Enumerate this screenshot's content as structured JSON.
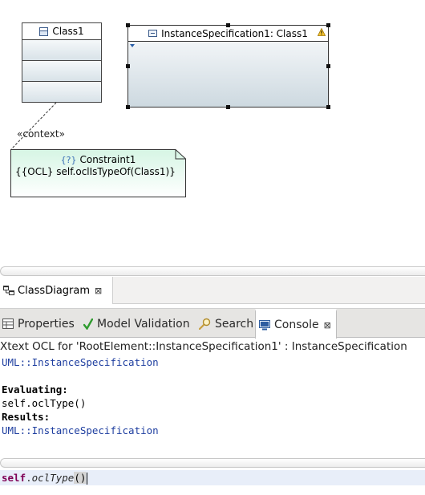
{
  "diagram": {
    "class_name": "Class1",
    "instance_label": "InstanceSpecification1: Class1",
    "context_label": "«context»",
    "constraint_name": "Constraint1",
    "constraint_prefix": "{?}",
    "constraint_body": "{{OCL} self.oclIsTypeOf(Class1)}"
  },
  "editor_tabs": [
    {
      "label": "ClassDiagram",
      "close": "⊠"
    }
  ],
  "view_tabs": [
    {
      "label": "Properties",
      "icon": "properties-icon"
    },
    {
      "label": "Model Validation",
      "icon": "check-icon"
    },
    {
      "label": "Search",
      "icon": "search-icon"
    },
    {
      "label": "Console",
      "icon": "console-icon",
      "close": "⊠",
      "active": true
    }
  ],
  "console": {
    "title": "Xtext OCL for 'RootElement::InstanceSpecification1' : InstanceSpecification",
    "lines": [
      "UML::InstanceSpecification",
      "",
      "Evaluating:",
      "self.oclType()",
      "Results:",
      "UML::InstanceSpecification"
    ]
  },
  "input": {
    "keyword": "self",
    "dot": ".",
    "operation": "oclType",
    "open": "(",
    "close": ")"
  },
  "colors": {
    "type_text": "#1f3fa0",
    "keyword": "#7f0055",
    "input_bg": "#e8eef9",
    "validation_check": "#2e9b2e"
  }
}
